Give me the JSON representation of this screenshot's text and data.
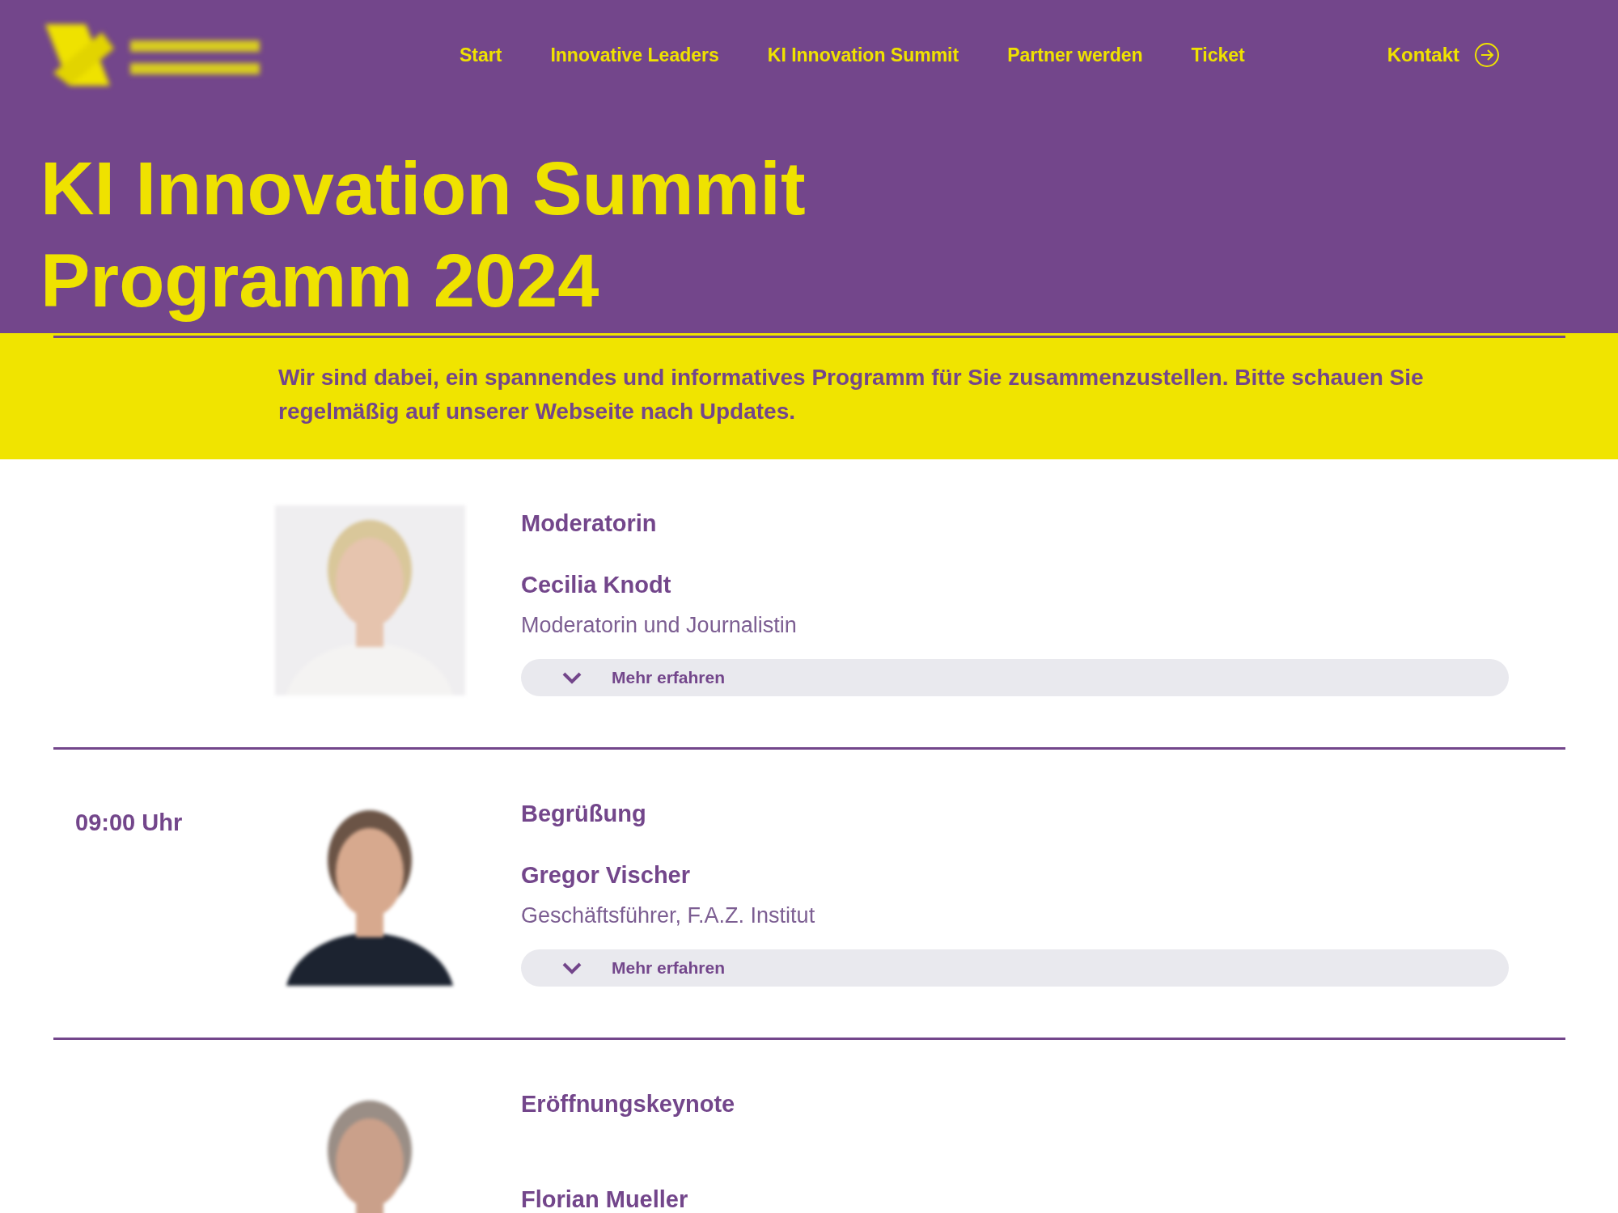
{
  "nav": {
    "items": [
      {
        "label": "Start"
      },
      {
        "label": "Innovative Leaders"
      },
      {
        "label": "KI Innovation Summit"
      },
      {
        "label": "Partner werden"
      },
      {
        "label": "Ticket"
      }
    ],
    "contact": "Kontakt"
  },
  "hero": {
    "title_lines": [
      "KI Innovation Summit",
      "Programm 2024"
    ]
  },
  "notice": "Wir sind dabei, ein spannendes und informatives Programm für Sie zusammenzustellen. Bitte schauen Sie regelmäßig auf unserer Webseite nach Updates.",
  "sessions": [
    {
      "title": "Moderatorin",
      "speaker": "Cecilia Knodt",
      "role": "Moderatorin und Journalistin",
      "button": "Mehr erfahren",
      "expanded": false
    },
    {
      "time": "09:00 Uhr",
      "title": "Begrüßung",
      "speaker": "Gregor Vischer",
      "role": "Geschäftsführer, F.A.Z. Institut",
      "button": "Mehr erfahren",
      "expanded": false
    },
    {
      "title": "Eröffnungskeynote",
      "speaker": "Florian Mueller"
    }
  ]
}
